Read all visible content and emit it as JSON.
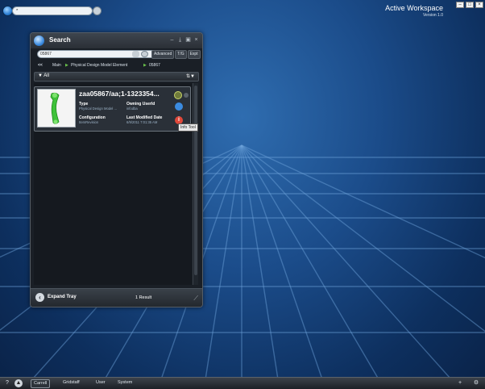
{
  "app": {
    "title": "Active Workspace",
    "version": "Version 1.0",
    "global_search_value": "*"
  },
  "panel": {
    "title": "Search",
    "query": "05867",
    "buttons": [
      "Advanced",
      "T/G",
      "Expt"
    ],
    "breadcrumb": {
      "back": "<<",
      "items": [
        "Main",
        "Physical Design Model Element",
        "05867"
      ]
    },
    "filter_label": "All",
    "result": {
      "name": "zaa05867/aa;1-1323354...",
      "type_label": "Type",
      "type_value": "Physical Design Model ...",
      "owner_label": "Owning UserId",
      "owner_value": "infodba",
      "config_label": "Configuration",
      "config_value": "ItemRevision",
      "modified_label": "Last Modified Date",
      "modified_value": "6/9/2011 7:01:35 AM",
      "tooltip": "Info Tool"
    },
    "footer": {
      "expand_label": "Expand Tray",
      "result_count": "1 Result"
    }
  },
  "taskbar": {
    "items": [
      "Carrell",
      "Gridstaff",
      "User",
      "System"
    ]
  },
  "colors": {
    "accent_green": "#69c04a",
    "info_red": "#e0483a",
    "link_blue": "#3b8be0"
  }
}
